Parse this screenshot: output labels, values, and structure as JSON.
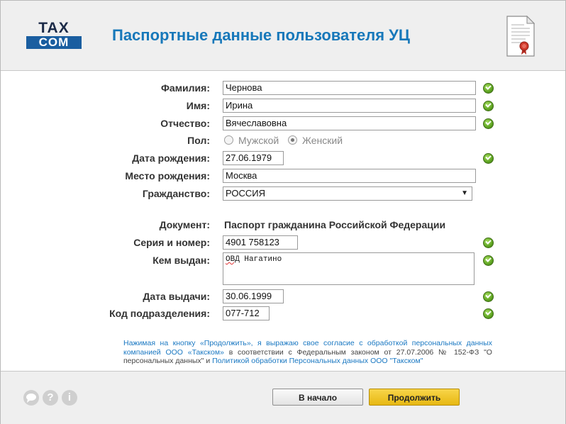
{
  "header": {
    "logo_top": "TAX",
    "logo_bottom": "COM",
    "title": "Паспортные данные пользователя УЦ"
  },
  "form": {
    "surname": {
      "label": "Фамилия:",
      "value": "Чернова"
    },
    "name": {
      "label": "Имя:",
      "value": "Ирина"
    },
    "patronymic": {
      "label": "Отчество:",
      "value": "Вячеславовна"
    },
    "gender": {
      "label": "Пол:",
      "male": "Мужской",
      "female": "Женский",
      "selected": "Женский"
    },
    "birth_date": {
      "label": "Дата рождения:",
      "value": "27.06.1979"
    },
    "birth_place": {
      "label": "Место рождения:",
      "value": "Москва"
    },
    "citizenship": {
      "label": "Гражданство:",
      "value": "РОССИЯ"
    },
    "document": {
      "label": "Документ:",
      "value": "Паспорт гражданина Российской Федерации"
    },
    "series_number": {
      "label": "Серия и номер:",
      "value": "4901 758123"
    },
    "issued_by": {
      "label": "Кем выдан:",
      "value_word": "ОВД",
      "value_rest": " Нагатино"
    },
    "issue_date": {
      "label": "Дата выдачи:",
      "value": "30.06.1999"
    },
    "division_code": {
      "label": "Код подразделения:",
      "value": "077-712"
    }
  },
  "consent": {
    "part1": "Нажимая на кнопку «Продолжить», я выражаю свое согласие с обработкой персональных данных компанией ООО «Такском»",
    "part2": " в соответствии с Федеральным законом от 27.07.2006 № 152-ФЗ \"О персональных данных\" и ",
    "part3": "Политикой обработки Персональных данных ООО \"Такском\""
  },
  "footer": {
    "chat_icon": "chat-icon",
    "help_icon": "help-icon",
    "help_glyph": "?",
    "info_icon": "info-icon",
    "info_glyph": "i",
    "back_label": "В начало",
    "next_label": "Продолжить"
  },
  "colors": {
    "title": "#1778ba",
    "accent_button": "#f1c62e",
    "valid_icon": "#5da321",
    "link": "#1a78c2"
  }
}
